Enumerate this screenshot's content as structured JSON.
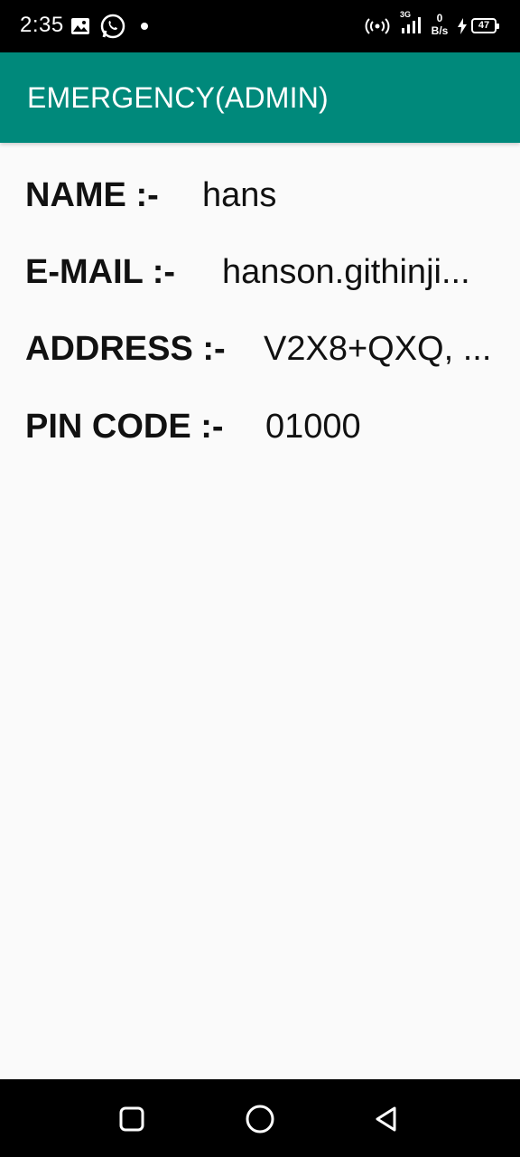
{
  "status_bar": {
    "time": "2:35",
    "net_speed_value": "0",
    "net_speed_unit": "B/s",
    "network_type": "3G",
    "battery": "47",
    "icons": [
      "image-icon",
      "whatsapp-icon",
      "notification-dot",
      "hotspot-icon",
      "signal-icon",
      "charging-icon",
      "battery-icon"
    ]
  },
  "app_bar": {
    "title": "EMERGENCY(ADMIN)",
    "color": "#00897b"
  },
  "details": [
    {
      "label": "NAME :-",
      "value": "hans"
    },
    {
      "label": "E-MAIL :-",
      "value": "hanson.githinji..."
    },
    {
      "label": "ADDRESS :-",
      "value": "V2X8+QXQ, ..."
    },
    {
      "label": "PIN CODE :-",
      "value": "01000"
    }
  ],
  "nav_bar": {
    "icons": [
      "recent-apps-icon",
      "home-icon",
      "back-icon"
    ]
  }
}
